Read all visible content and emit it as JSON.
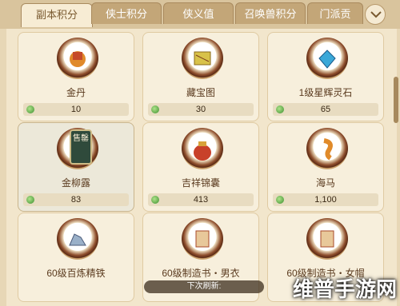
{
  "tabs": [
    "副本积分",
    "侠士积分",
    "侠义值",
    "召唤兽积分",
    "门派贡"
  ],
  "active_tab": 0,
  "dropdown_icon": "chevron-down-icon",
  "items": [
    {
      "name": "金丹",
      "price": "10",
      "icon": "golden-pill-icon"
    },
    {
      "name": "藏宝图",
      "price": "30",
      "icon": "treasure-map-icon"
    },
    {
      "name": "1级星辉灵石",
      "price": "65",
      "icon": "blue-gem-icon"
    },
    {
      "name": "金柳露",
      "price": "83",
      "icon": "bottle-icon",
      "seal": "售罄"
    },
    {
      "name": "吉祥锦囊",
      "price": "413",
      "icon": "lucky-bag-icon"
    },
    {
      "name": "海马",
      "price": "1,100",
      "icon": "seahorse-icon"
    },
    {
      "name": "60级百炼精铁",
      "price": "",
      "icon": "iron-ore-icon"
    },
    {
      "name": "60级制造书・男衣",
      "price": "",
      "icon": "scroll-icon"
    },
    {
      "name": "60级制造书・女帽",
      "price": "",
      "icon": "scroll-icon"
    }
  ],
  "toast": "下次刷新:",
  "watermark": "维普手游网",
  "colors": {
    "panel": "#f2e6cc",
    "tab_active": "#f7ecd4",
    "tab_inactive": "#c3a678",
    "coin": "#3d8f2f"
  }
}
